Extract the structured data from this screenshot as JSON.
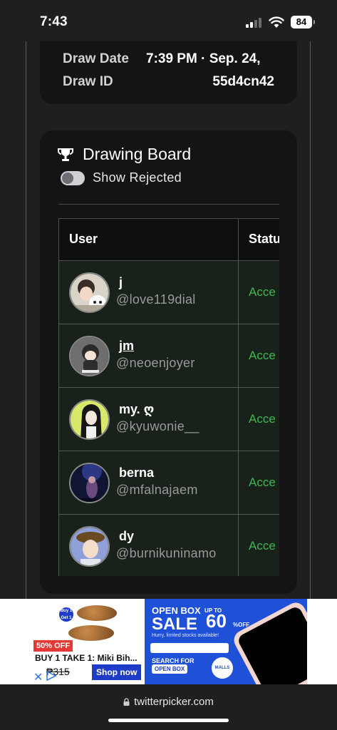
{
  "status_bar": {
    "time": "7:43",
    "battery": "84"
  },
  "draw_info": {
    "date_label": "Draw Date",
    "date_value": "7:39 PM · Sep. 24,",
    "id_label": "Draw ID",
    "id_value": "55d4cn42"
  },
  "board": {
    "title": "Drawing Board",
    "toggle_label": "Show Rejected",
    "toggle_on": false,
    "columns": {
      "user": "User",
      "status": "Statu"
    },
    "rows": [
      {
        "name": "j",
        "handle": "@love119dial",
        "status": "Acce",
        "avatar": "avatar-1"
      },
      {
        "name": "jm",
        "handle": "@neoenjoyer",
        "status": "Acce",
        "avatar": "avatar-2"
      },
      {
        "name": "my. ღ",
        "handle": "@kyuwonie__",
        "status": "Acce",
        "avatar": "avatar-3"
      },
      {
        "name": "berna",
        "handle": "@mfalnajaem",
        "status": "Acce",
        "avatar": "avatar-4"
      },
      {
        "name": "dy",
        "handle": "@burnikuninamo",
        "status": "Acce",
        "avatar": "avatar-5"
      }
    ],
    "status_color": "#3fb950"
  },
  "ad": {
    "left": {
      "badge": "50% OFF",
      "title": "BUY 1 TAKE 1: Miki Bih...",
      "price": "₱315",
      "button": "Shop now",
      "bubble": "Buy 1 Get 1"
    },
    "right": {
      "headline_1": "OPEN BOX",
      "headline_2": "SALE",
      "up_to": "UP TO",
      "percent": "60",
      "off": "%OFF",
      "sub": "Hurry, limited stocks available!",
      "search_for": "SEARCH FOR",
      "open_box": "OPEN BOX",
      "malls": "MALLS ONLINE"
    }
  },
  "browser": {
    "url": "twitterpicker.com"
  }
}
